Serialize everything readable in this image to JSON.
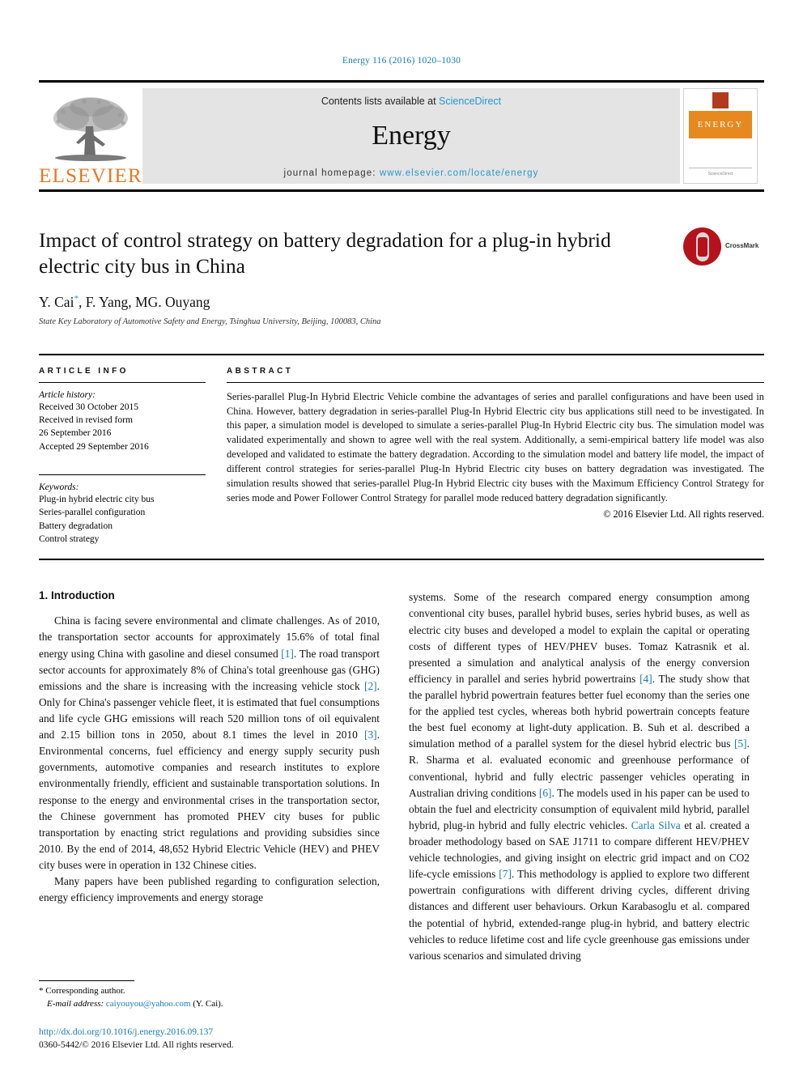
{
  "running_head": "Energy 116 (2016) 1020–1030",
  "masthead": {
    "publisher_name": "ELSEVIER",
    "contents_prefix": "Contents lists available at ",
    "sciencedirect": "ScienceDirect",
    "journal_name": "Energy",
    "homepage_prefix": "journal homepage: ",
    "homepage_url": "www.elsevier.com/locate/energy",
    "cover_band_text": "ENERGY",
    "cover_footer": "ScienceDirect"
  },
  "article": {
    "title": "Impact of control strategy on battery degradation for a plug-in hybrid electric city bus in China",
    "authors": "Y. Cai",
    "authors_rest": ", F. Yang, MG. Ouyang",
    "corresponding_marker": "*",
    "affiliation": "State Key Laboratory of Automotive Safety and Energy, Tsinghua University, Beijing, 100083, China",
    "crossmark_label": "CrossMark"
  },
  "article_info": {
    "heading": "ARTICLE INFO",
    "history_label": "Article history:",
    "history": [
      "Received 30 October 2015",
      "Received in revised form",
      "26 September 2016",
      "Accepted 29 September 2016"
    ],
    "keywords_label": "Keywords:",
    "keywords": [
      "Plug-in hybrid electric city bus",
      "Series-parallel configuration",
      "Battery degradation",
      "Control strategy"
    ]
  },
  "abstract": {
    "heading": "ABSTRACT",
    "text": "Series-parallel Plug-In Hybrid Electric Vehicle combine the advantages of series and parallel configurations and have been used in China. However, battery degradation in series-parallel Plug-In Hybrid Electric city bus applications still need to be investigated. In this paper, a simulation model is developed to simulate a series-parallel Plug-In Hybrid Electric city bus. The simulation model was validated experimentally and shown to agree well with the real system. Additionally, a semi-empirical battery life model was also developed and validated to estimate the battery degradation. According to the simulation model and battery life model, the impact of different control strategies for series-parallel Plug-In Hybrid Electric city buses on battery degradation was investigated. The simulation results showed that series-parallel Plug-In Hybrid Electric city buses with the Maximum Efficiency Control Strategy for series mode and Power Follower Control Strategy for parallel mode reduced battery degradation significantly.",
    "copyright": "© 2016 Elsevier Ltd. All rights reserved."
  },
  "body": {
    "section_number_title": "1. Introduction",
    "left_paragraph_1_a": "China is facing severe environmental and climate challenges. As of 2010, the transportation sector accounts for approximately 15.6% of total final energy using China with gasoline and diesel consumed ",
    "ref1": "[1]",
    "left_paragraph_1_b": ". The road transport sector accounts for approximately 8% of China's total greenhouse gas (GHG) emissions and the share is increasing with the increasing vehicle stock ",
    "ref2": "[2]",
    "left_paragraph_1_c": ". Only for China's passenger vehicle fleet, it is estimated that fuel consumptions and life cycle GHG emissions will reach 520 million tons of oil equivalent and 2.15 billion tons in 2050, about 8.1 times the level in 2010 ",
    "ref3": "[3]",
    "left_paragraph_1_d": ". Environmental concerns, fuel efficiency and energy supply security push governments, automotive companies and research institutes to explore environmentally friendly, efficient and sustainable transportation solutions. In response to the energy and environmental crises in the transportation sector, the Chinese government has promoted PHEV city buses for public transportation by enacting strict regulations and providing subsidies since 2010. By the end of 2014, 48,652 Hybrid Electric Vehicle (HEV) and PHEV city buses were in operation in 132 Chinese cities.",
    "left_paragraph_2": "Many papers have been published regarding to configuration selection, energy efficiency improvements and energy storage",
    "right_paragraph_a": "systems. Some of the research compared energy consumption among conventional city buses, parallel hybrid buses, series hybrid buses, as well as electric city buses and developed a model to explain the capital or operating costs of different types of HEV/PHEV buses. Tomaz Katrasnik et al. presented a simulation and analytical analysis of the energy conversion efficiency in parallel and series hybrid powertrains ",
    "ref4": "[4]",
    "right_paragraph_b": ". The study show that the parallel hybrid powertrain features better fuel economy than the series one for the applied test cycles, whereas both hybrid powertrain concepts feature the best fuel economy at light-duty application. B. Suh et al. described a simulation method of a parallel system for the diesel hybrid electric bus ",
    "ref5": "[5]",
    "right_paragraph_c": ". R. Sharma et al. evaluated economic and greenhouse performance of conventional, hybrid and fully electric passenger vehicles operating in Australian driving conditions ",
    "ref6": "[6]",
    "right_paragraph_d": ". The models used in his paper can be used to obtain the fuel and electricity consumption of equivalent mild hybrid, parallel hybrid, plug-in hybrid and fully electric vehicles. ",
    "author_link": "Carla Silva",
    "right_paragraph_e": " et al. created a broader methodology based on SAE J1711 to compare different HEV/PHEV vehicle technologies, and giving insight on electric grid impact and on CO2 life-cycle emissions ",
    "ref7": "[7]",
    "right_paragraph_f": ". This methodology is applied to explore two different powertrain configurations with different driving cycles, different driving distances and different user behaviours. Orkun Karabasoglu et al. compared the potential of hybrid, extended-range plug-in hybrid, and battery electric vehicles to reduce lifetime cost and life cycle greenhouse gas emissions under various scenarios and simulated driving"
  },
  "footnotes": {
    "corresponding_marker": "*",
    "corresponding_text": "Corresponding author.",
    "email_label": "E-mail address:",
    "email": "caiyouyou@yahoo.com",
    "email_suffix": "(Y. Cai).",
    "doi": "http://dx.doi.org/10.1016/j.energy.2016.09.137",
    "issn": "0360-5442/© 2016 Elsevier Ltd. All rights reserved."
  },
  "colors": {
    "link_blue": "#1a7ab5",
    "sciencedirect_blue": "#2596d1",
    "elsevier_orange": "#e87722",
    "crossmark_red": "#b5121b",
    "masthead_gray": "#e4e4e4"
  }
}
